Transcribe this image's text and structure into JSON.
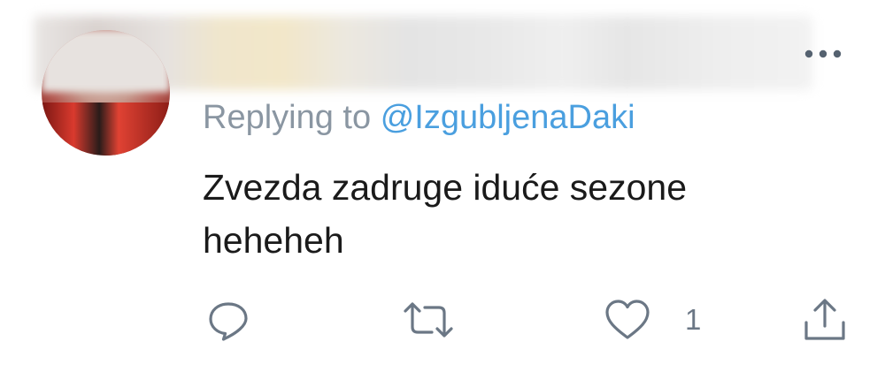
{
  "reply": {
    "prefix": "Replying to",
    "handle": "@IzgubljenaDaki"
  },
  "tweet": {
    "text_line1": "Zvezda zadruge iduće sezone",
    "text_line2": "heheheh"
  },
  "actions": {
    "reply_icon": "reply-bubble-icon",
    "retweet_icon": "retweet-icon",
    "like_icon": "heart-icon",
    "like_count": "1",
    "share_icon": "share-icon"
  },
  "colors": {
    "muted_text": "#8a96a2",
    "link": "#4a9fdf",
    "icon": "#6b7785",
    "body_text": "#1a1a1a"
  }
}
